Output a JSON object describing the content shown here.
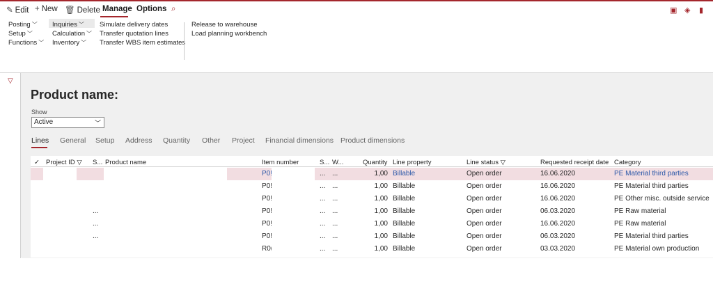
{
  "action_pane": {
    "edit": "Edit",
    "new": "New",
    "delete": "Delete",
    "manage": "Manage",
    "options": "Options"
  },
  "ribbon": {
    "posting": "Posting",
    "setup": "Setup",
    "functions": "Functions",
    "inquiries": "Inquiries",
    "calculation": "Calculation",
    "inventory": "Inventory",
    "simulate_delivery_dates": "Simulate delivery dates",
    "transfer_quotation_lines": "Transfer quotation lines",
    "transfer_wbs_item_estimates": "Transfer WBS item estimates",
    "release_to_warehouse": "Release to warehouse",
    "load_planning_workbench": "Load planning workbench"
  },
  "page": {
    "title": "Product name:",
    "show_label": "Show",
    "show_value": "Active"
  },
  "tabs": [
    "Lines",
    "General",
    "Setup",
    "Address",
    "Quantity",
    "Other",
    "Project",
    "Financial dimensions",
    "Product dimensions"
  ],
  "grid": {
    "headers": {
      "check": "✓",
      "project_id": "Project ID",
      "s": "S...",
      "product_name": "Product name",
      "item_number": "Item number",
      "s2": "S...",
      "w": "W...",
      "quantity": "Quantity",
      "line_property": "Line property",
      "line_status": "Line status",
      "requested_receipt_date": "Requested receipt date",
      "category": "Category"
    },
    "rows": [
      {
        "s": "",
        "item": "P0!",
        "s2": "...",
        "w": "...",
        "qty": "1,00",
        "prop": "Billable",
        "status": "Open order",
        "date": "16.06.2020",
        "category": "PE Material third parties"
      },
      {
        "s": "",
        "item": "P0!",
        "s2": "...",
        "w": "...",
        "qty": "1,00",
        "prop": "Billable",
        "status": "Open order",
        "date": "16.06.2020",
        "category": "PE Material third parties"
      },
      {
        "s": "",
        "item": "P0!",
        "s2": "...",
        "w": "...",
        "qty": "1,00",
        "prop": "Billable",
        "status": "Open order",
        "date": "16.06.2020",
        "category": "PE Other misc. outside service"
      },
      {
        "s": "...",
        "item": "P0!",
        "s2": "...",
        "w": "...",
        "qty": "1,00",
        "prop": "Billable",
        "status": "Open order",
        "date": "06.03.2020",
        "category": "PE Raw material"
      },
      {
        "s": "...",
        "item": "P0!",
        "s2": "...",
        "w": "...",
        "qty": "1,00",
        "prop": "Billable",
        "status": "Open order",
        "date": "16.06.2020",
        "category": "PE Raw material"
      },
      {
        "s": "...",
        "item": "P0!",
        "s2": "...",
        "w": "...",
        "qty": "1,00",
        "prop": "Billable",
        "status": "Open order",
        "date": "06.03.2020",
        "category": "PE Material third parties"
      },
      {
        "s": "",
        "item": "R0(",
        "s2": "...",
        "w": "...",
        "qty": "1,00",
        "prop": "Billable",
        "status": "Open order",
        "date": "03.03.2020",
        "category": "PE Material own production"
      }
    ]
  },
  "colors": {
    "accent": "#a4262c",
    "selected_row": "#f2dde1",
    "link": "#2b57a8"
  },
  "icons": [
    "edit-icon",
    "plus-icon",
    "trash-icon",
    "search-icon",
    "office-icon",
    "link-icon",
    "attach-icon",
    "filter-icon",
    "chevron-down-icon"
  ]
}
